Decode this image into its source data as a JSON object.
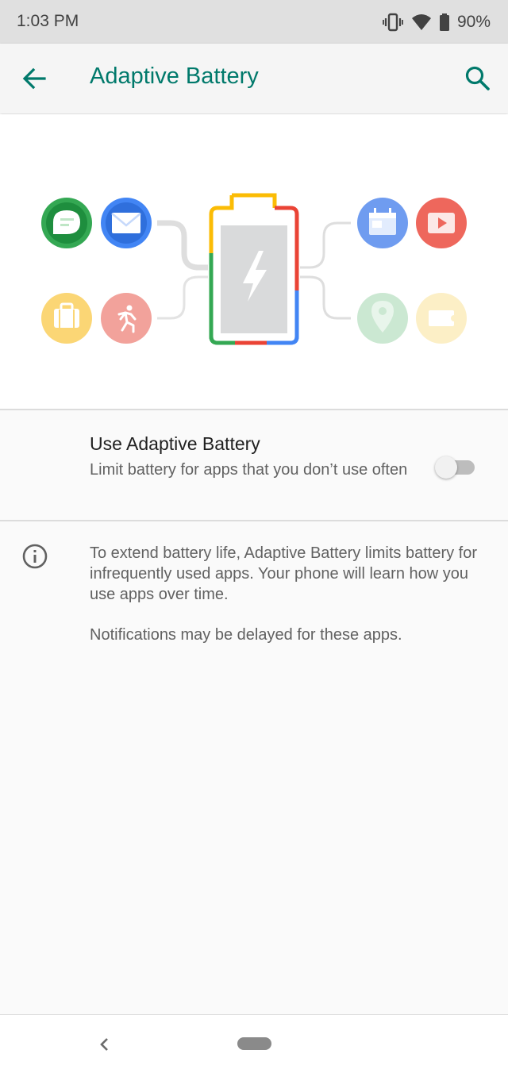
{
  "status_bar": {
    "time": "1:03 PM",
    "battery_percent": "90%",
    "icons": [
      "vibrate-icon",
      "wifi-icon",
      "battery-icon"
    ]
  },
  "app_bar": {
    "title": "Adaptive Battery",
    "back_icon": "arrow-left-icon",
    "search_icon": "search-icon",
    "accent_color": "#00796b"
  },
  "illustration": {
    "left_apps": [
      "message-app-icon",
      "mail-app-icon",
      "briefcase-app-icon",
      "run-app-icon"
    ],
    "right_apps": [
      "calendar-app-icon",
      "video-app-icon",
      "location-app-icon",
      "ticket-app-icon"
    ],
    "center": "battery-charging-icon",
    "colors": {
      "green": "#34a853",
      "blue": "#4285f4",
      "yellow": "#fbbc05",
      "red": "#ea4335"
    }
  },
  "preference": {
    "title": "Use Adaptive Battery",
    "summary": "Limit battery for apps that you don’t use often",
    "toggle_on": false
  },
  "info": {
    "paragraph1": "To extend battery life, Adaptive Battery limits battery for infrequently used apps. Your phone will learn how you use apps over time.",
    "paragraph2": "Notifications may be delayed for these apps."
  },
  "nav_bar": {
    "back_icon": "nav-back-icon",
    "home_icon": "nav-home-pill"
  }
}
